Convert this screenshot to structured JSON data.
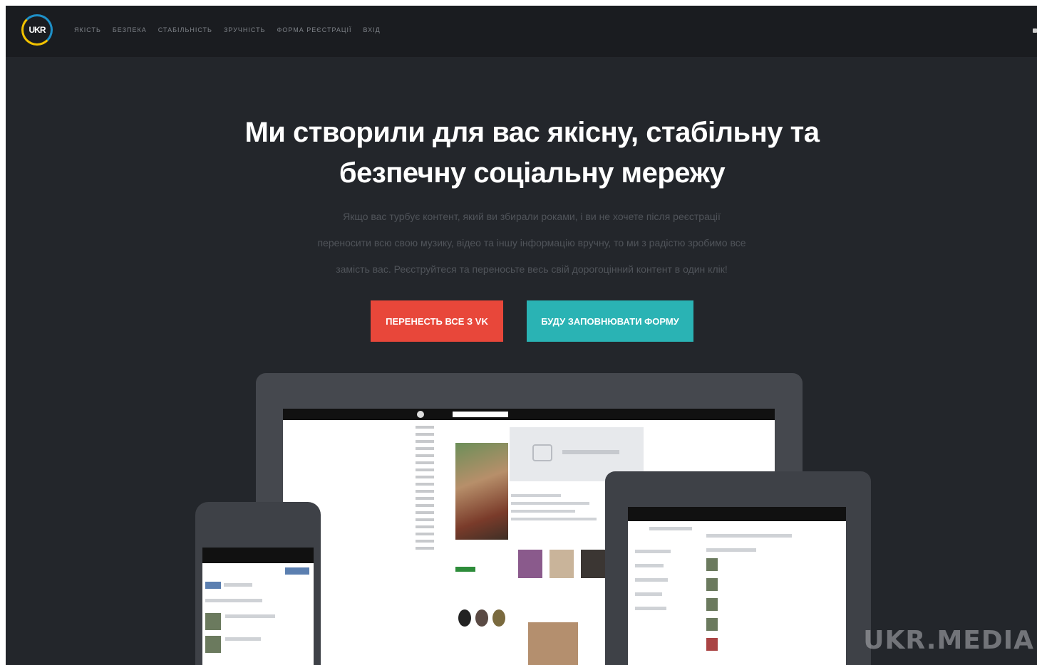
{
  "brand": {
    "logo_text": "UKR",
    "logo_colors": [
      "#1e90c8",
      "#f2c200"
    ]
  },
  "nav": {
    "items": [
      "Якість",
      "Безпека",
      "Стабільність",
      "Зручність",
      "Форма реєстрації",
      "Вхід"
    ]
  },
  "hero": {
    "headline_line1": "Ми створили для вас якісну, стабільну та",
    "headline_line2": "безпечну соціальну мережу",
    "subtext_line1": "Якщо вас турбує контент, який ви збирали роками, і ви не хочете після реєстрації",
    "subtext_line2": "переносити всю свою музику, відео та іншу інформацію вручну, то ми з радістю зробимо все",
    "subtext_line3": "замість вас. Реєструйтеся та переносьте весь свій дорогоцінний контент в один клік!"
  },
  "buttons": {
    "import_vk": "ПЕРЕНЕСТЬ ВСЕ З VK",
    "fill_form": "БУДУ ЗАПОВНЮВАТИ ФОРМУ"
  },
  "colors": {
    "background": "#23262b",
    "topbar": "#1a1c20",
    "button_red": "#e8473a",
    "button_teal": "#2ab3b4"
  },
  "watermark": "UKR.MEDIA"
}
